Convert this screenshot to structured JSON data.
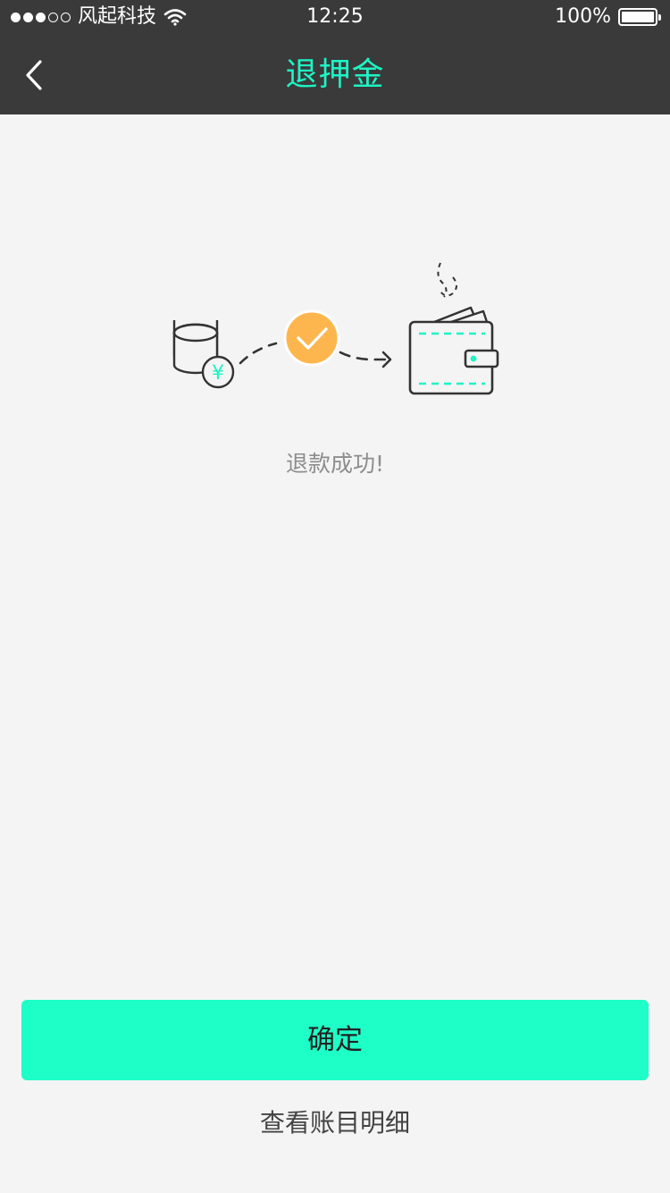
{
  "status_bar": {
    "carrier": "风起科技",
    "time": "12:25",
    "battery": "100%",
    "signal_dots_full": 3,
    "signal_dots_total": 5
  },
  "nav": {
    "title": "退押金",
    "back_icon": "chevron-left-icon"
  },
  "illustration": {
    "icons": [
      "coin-stack-icon",
      "yuan-coin-icon",
      "checkmark-circle-icon",
      "arrow-icon",
      "wallet-icon"
    ],
    "yuan_symbol": "¥"
  },
  "result": {
    "message": "退款成功!"
  },
  "actions": {
    "confirm_label": "确定",
    "detail_link": "查看账目明细"
  },
  "colors": {
    "accent": "#1df5c5",
    "button": "#1effc7",
    "check": "#fdb64d",
    "header_bg": "#3a3a3a",
    "page_bg": "#f4f4f4"
  }
}
